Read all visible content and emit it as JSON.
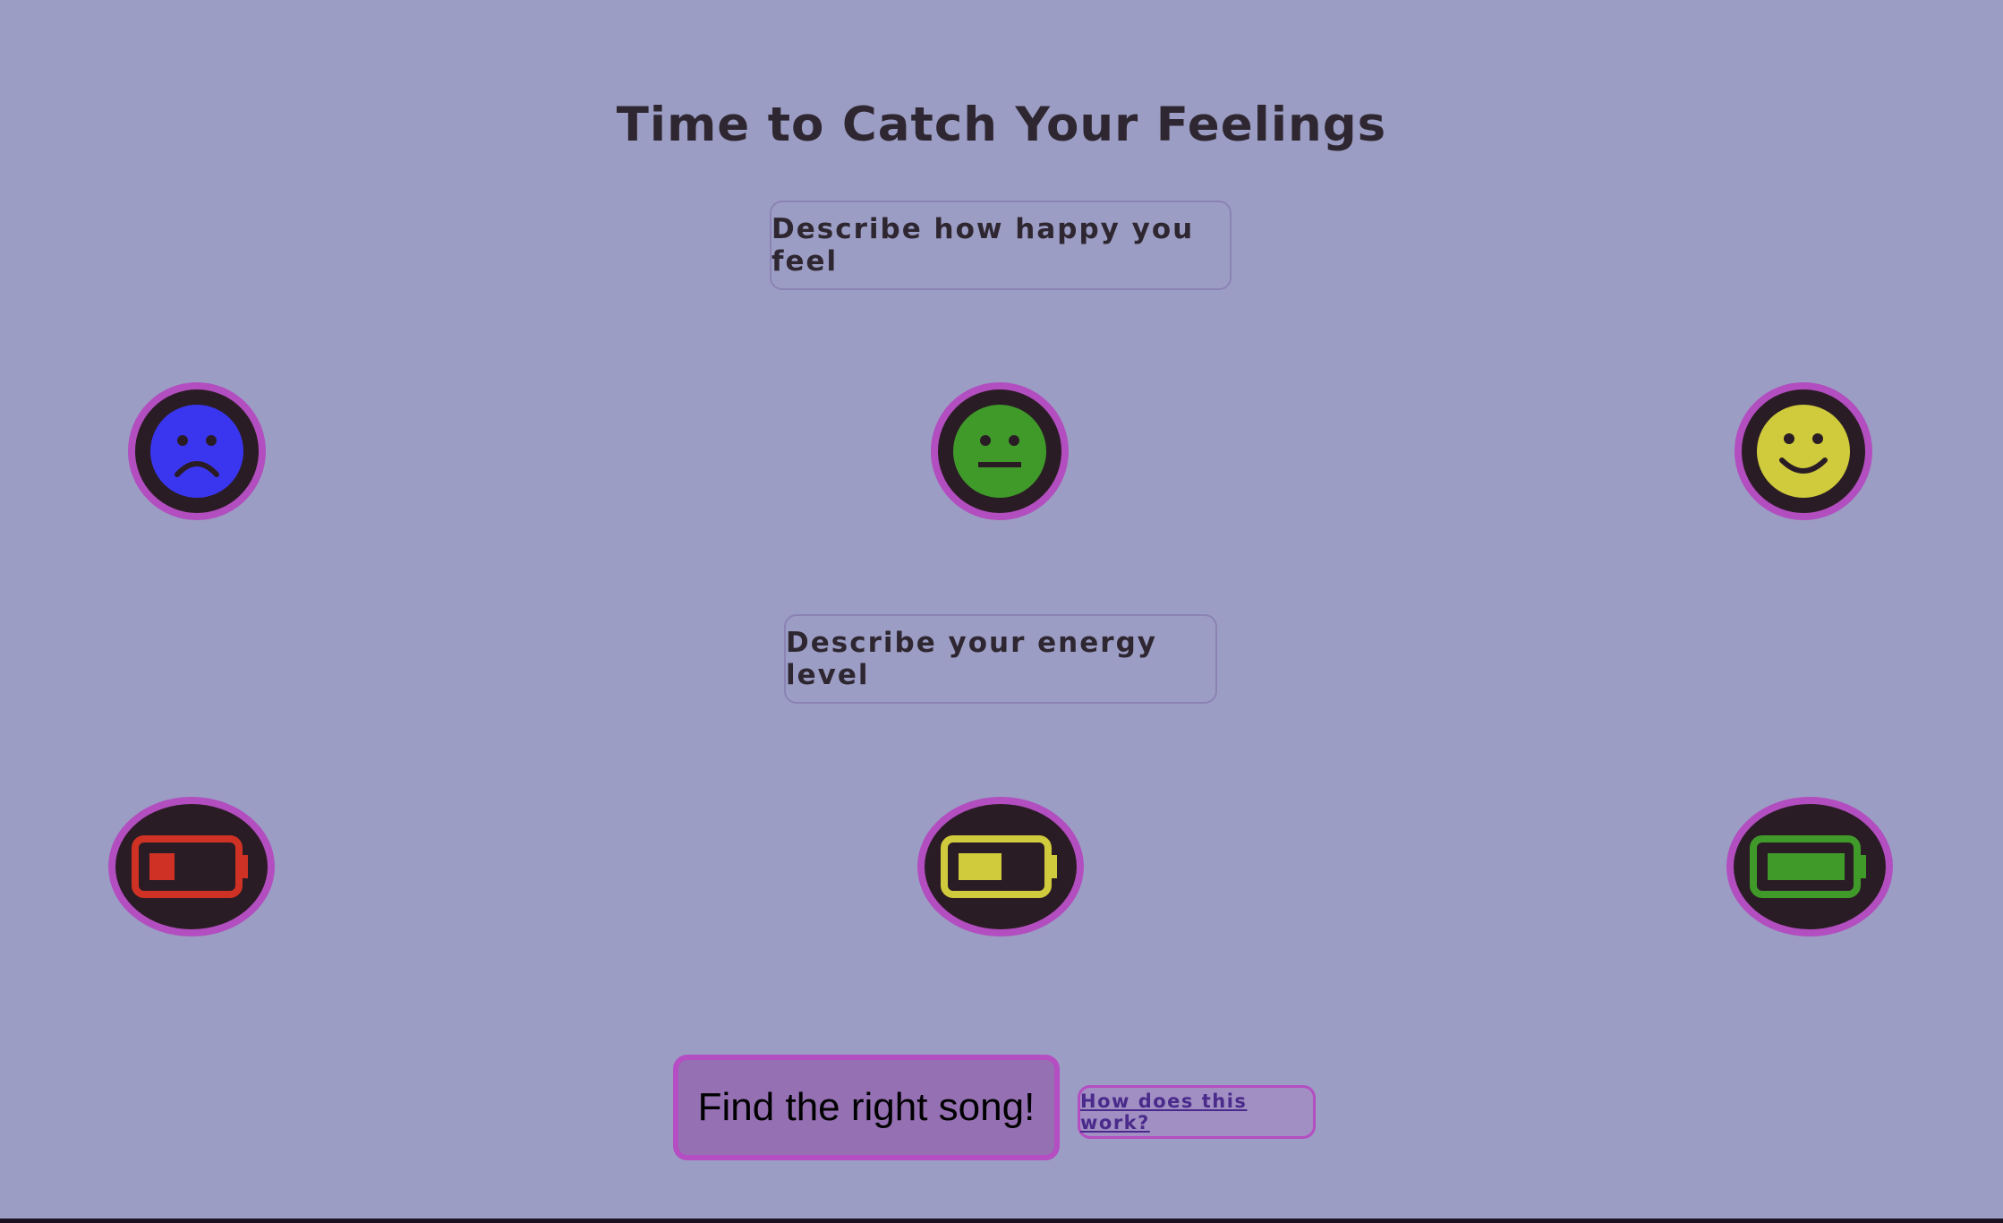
{
  "page": {
    "title": "Time to Catch Your Feelings"
  },
  "happiness": {
    "prompt": "Describe how happy you feel",
    "options": [
      {
        "icon": "sad-face-icon",
        "color": "#3a36f0"
      },
      {
        "icon": "neutral-face-icon",
        "color": "#3f9a2a"
      },
      {
        "icon": "happy-face-icon",
        "color": "#cfcb3c"
      }
    ]
  },
  "energy": {
    "prompt": "Describe your energy level",
    "options": [
      {
        "icon": "battery-low-icon",
        "color": "#cf3224",
        "fill": 0.2
      },
      {
        "icon": "battery-medium-icon",
        "color": "#cfcb3c",
        "fill": 0.5
      },
      {
        "icon": "battery-full-icon",
        "color": "#3f9a2a",
        "fill": 1.0
      }
    ]
  },
  "actions": {
    "find_label": "Find the right song!",
    "how_label": "How does this work?"
  },
  "colors": {
    "background": "#9c9dc4",
    "accent_border": "#b24ec0",
    "button_fill": "#9570b2",
    "text": "#2e2630"
  }
}
